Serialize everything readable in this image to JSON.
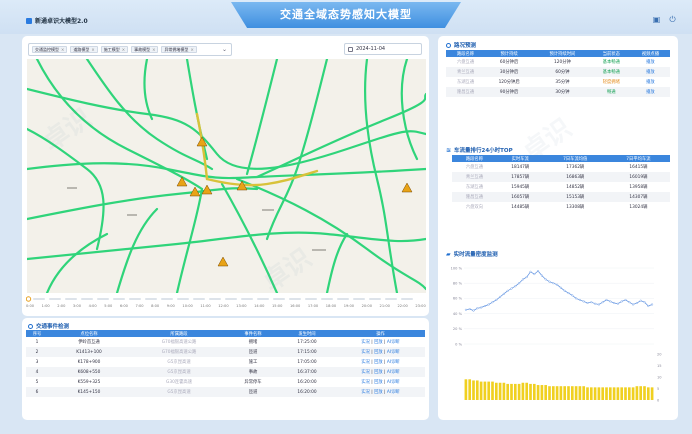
{
  "header": {
    "title": "交通全域态势感知大模型",
    "logo_text": "新通卓识大模型2.0"
  },
  "filters": {
    "chips": [
      "交通监控模型",
      "道路模型",
      "施工模型",
      "事故模型",
      "异常拥堵模型"
    ],
    "date": "2024-11-04"
  },
  "timeline": {
    "ticks": [
      "0:00",
      "1:00",
      "2:00",
      "3:00",
      "4:00",
      "5:00",
      "6:00",
      "7:00",
      "8:00",
      "9:00",
      "10:00",
      "11:00",
      "12:00",
      "13:00",
      "14:00",
      "15:00",
      "16:00",
      "17:00",
      "18:00",
      "19:00",
      "20:00",
      "21:00",
      "22:00",
      "23:00"
    ]
  },
  "events": {
    "title": "交通事件检测",
    "columns": [
      "序号",
      "点位名称",
      "所属路段",
      "事件名称",
      "发生时间",
      "操作"
    ],
    "rows": [
      {
        "no": "1",
        "point": "伊岭首互通",
        "road": "G70福银高速公路",
        "type": "拥堵",
        "time": "17:25:00"
      },
      {
        "no": "2",
        "point": "K1413+100",
        "road": "G70福银高速公路",
        "type": "匝道",
        "time": "17:15:00"
      },
      {
        "no": "3",
        "point": "K178+900",
        "road": "G5京昆高速",
        "type": "施工",
        "time": "17:05:00"
      },
      {
        "no": "4",
        "point": "K608+550",
        "road": "G5京昆高速",
        "type": "事故",
        "time": "16:37:00"
      },
      {
        "no": "5",
        "point": "K559+325",
        "road": "G30连霍高速",
        "type": "异常停车",
        "time": "16:20:00"
      },
      {
        "no": "6",
        "point": "K145+150",
        "road": "G5京昆高速",
        "type": "匝道",
        "time": "16:20:00"
      }
    ],
    "actions": [
      "实况",
      "回放",
      "AI诊断"
    ]
  },
  "forecast": {
    "title": "路况预测",
    "columns": [
      "路段名称",
      "预计持续",
      "预计持续时间",
      "当前状态",
      "视频点播"
    ],
    "rows": [
      {
        "name": "六盘互通",
        "duration": "60分钟后",
        "time": "120分钟",
        "status": "基本畅通",
        "status_color": "green",
        "action": "播放"
      },
      {
        "name": "青兰互通",
        "duration": "30分钟后",
        "time": "60分钟",
        "status": "基本畅通",
        "status_color": "green",
        "action": "播放"
      },
      {
        "name": "东湖互通",
        "duration": "120分钟后",
        "time": "35分钟",
        "status": "轻度拥堵",
        "status_color": "orange",
        "action": "播放"
      },
      {
        "name": "隆昌互通",
        "duration": "90分钟后",
        "time": "30分钟",
        "status": "畅通",
        "status_color": "green",
        "action": "播放"
      }
    ]
  },
  "top": {
    "title": "车流量排行24小时TOP",
    "columns": [
      "路段名称",
      "实时车流",
      "7日车流均值",
      "7日平均车流"
    ],
    "rows": [
      {
        "name": "六盘互通",
        "live": "18147辆",
        "avg": "17362辆",
        "mean": "16415辆"
      },
      {
        "name": "青兰互通",
        "live": "17857辆",
        "avg": "16863辆",
        "mean": "16019辆"
      },
      {
        "name": "东湖互通",
        "live": "15945辆",
        "avg": "14852辆",
        "mean": "13958辆"
      },
      {
        "name": "隆昌互通",
        "live": "16057辆",
        "avg": "15153辆",
        "mean": "14307辆"
      },
      {
        "name": "六盘双向",
        "live": "14485辆",
        "avg": "13308辆",
        "mean": "13024辆"
      }
    ]
  },
  "chart_data": {
    "type": "line",
    "title": "实时流量密度监测",
    "ylim_left": [
      0,
      100
    ],
    "yticks_left": [
      "100 %",
      "80 %",
      "60 %",
      "40 %",
      "20 %",
      "0 %"
    ],
    "yticks_right": [
      "20",
      "15",
      "10",
      "5",
      "0"
    ],
    "series": [
      {
        "values": [
          45,
          46,
          44,
          47,
          48,
          50,
          52,
          55,
          58,
          62,
          66,
          70,
          73,
          76,
          80,
          85,
          88,
          95,
          92,
          96,
          90,
          85,
          82,
          80,
          78,
          74,
          70,
          67,
          64,
          60,
          58,
          56,
          54,
          55,
          53,
          52,
          55,
          58,
          56,
          54,
          53,
          56,
          58,
          55,
          52,
          54,
          57,
          55,
          50,
          52
        ]
      }
    ],
    "bars": [
      9,
      9,
      8.5,
      8.5,
      8,
      8,
      8,
      8,
      7.5,
      7.5,
      7.5,
      7,
      7,
      7,
      7,
      7.5,
      7.5,
      7,
      7,
      6.5,
      6.5,
      6.5,
      6,
      6,
      6,
      6,
      6,
      6,
      6,
      6,
      6,
      6,
      5.5,
      5.5,
      5.5,
      5.5,
      5.5,
      5.5,
      5.5,
      5.5,
      5.5,
      5.5,
      5.5,
      5.5,
      5.5,
      6,
      6,
      6,
      5.5,
      5.5
    ],
    "bars_ylim": [
      0,
      20
    ],
    "color_line": "#5b8fe0",
    "color_bar": "#f0d020"
  },
  "colors": {
    "accent": "#3b86dd",
    "road": "#2fd47a",
    "road_hi": "#d8c23a"
  }
}
